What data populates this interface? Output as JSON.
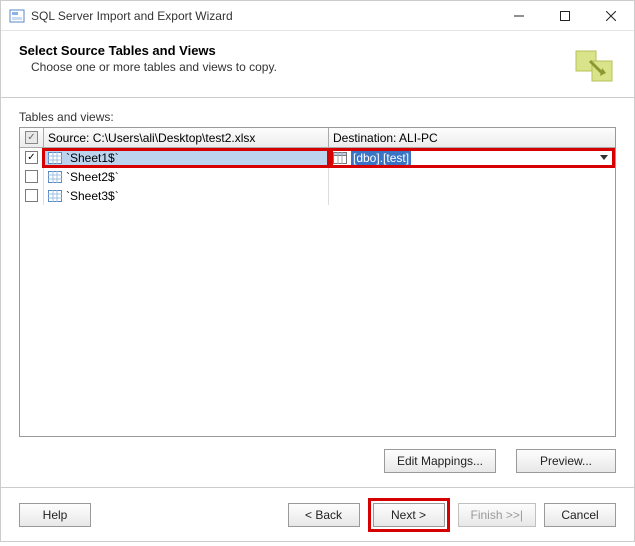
{
  "window": {
    "title": "SQL Server Import and Export Wizard"
  },
  "header": {
    "title": "Select Source Tables and Views",
    "subtitle": "Choose one or more tables and views to copy."
  },
  "tables_label": "Tables and views:",
  "grid": {
    "header_check_state": "checked-mixed",
    "source_header": "Source: C:\\Users\\ali\\Desktop\\test2.xlsx",
    "dest_header": "Destination: ALI-PC",
    "rows": [
      {
        "checked": true,
        "source": "`Sheet1$`",
        "dest": "[dbo].[test]",
        "selected": true
      },
      {
        "checked": false,
        "source": "`Sheet2$`",
        "dest": ""
      },
      {
        "checked": false,
        "source": "`Sheet3$`",
        "dest": ""
      }
    ]
  },
  "buttons": {
    "edit_mappings": "Edit Mappings...",
    "preview": "Preview...",
    "help": "Help",
    "back": "< Back",
    "next": "Next >",
    "finish": "Finish >>|",
    "cancel": "Cancel"
  }
}
